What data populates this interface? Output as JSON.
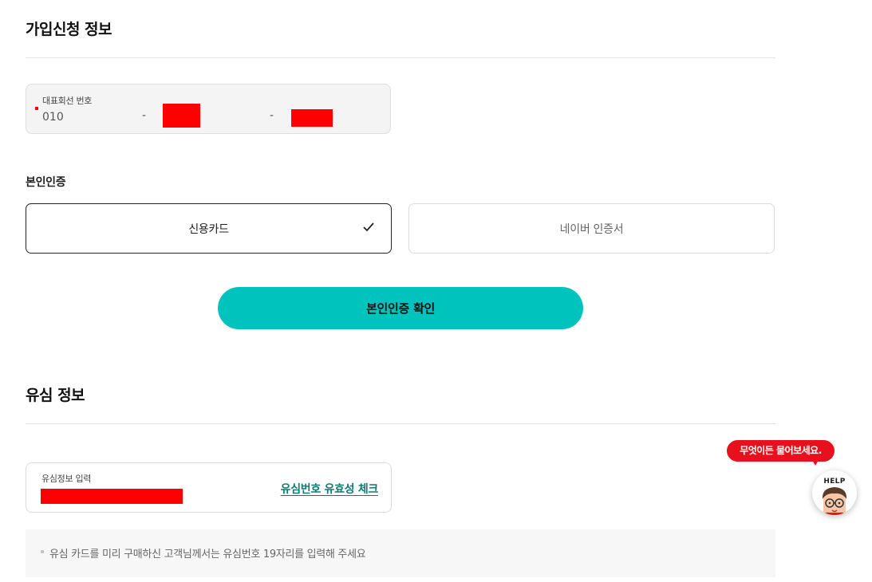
{
  "section_join": {
    "title": "가입신청 정보"
  },
  "phone": {
    "label": "대표회선 번호",
    "prefix": "010",
    "separator": "-"
  },
  "identity": {
    "label": "본인인증",
    "options": [
      {
        "label": "신용카드",
        "selected": true
      },
      {
        "label": "네이버 인증서",
        "selected": false
      }
    ],
    "confirm_label": "본인인증 확인"
  },
  "section_usim": {
    "title": "유심 정보"
  },
  "usim": {
    "label": "유심정보 입력",
    "check_label": "유심번호 유효성 체크",
    "notice": "유심 카드를 미리 구매하신 고객님께서는 유심번호 19자리를 입력해 주세요"
  },
  "help": {
    "bubble": "무엇이든 물어보세요.",
    "label": "HELP"
  },
  "colors": {
    "accent": "#00c3bd",
    "link": "#0c7c73",
    "help_red": "#e8101c",
    "redaction": "#ff0000"
  }
}
